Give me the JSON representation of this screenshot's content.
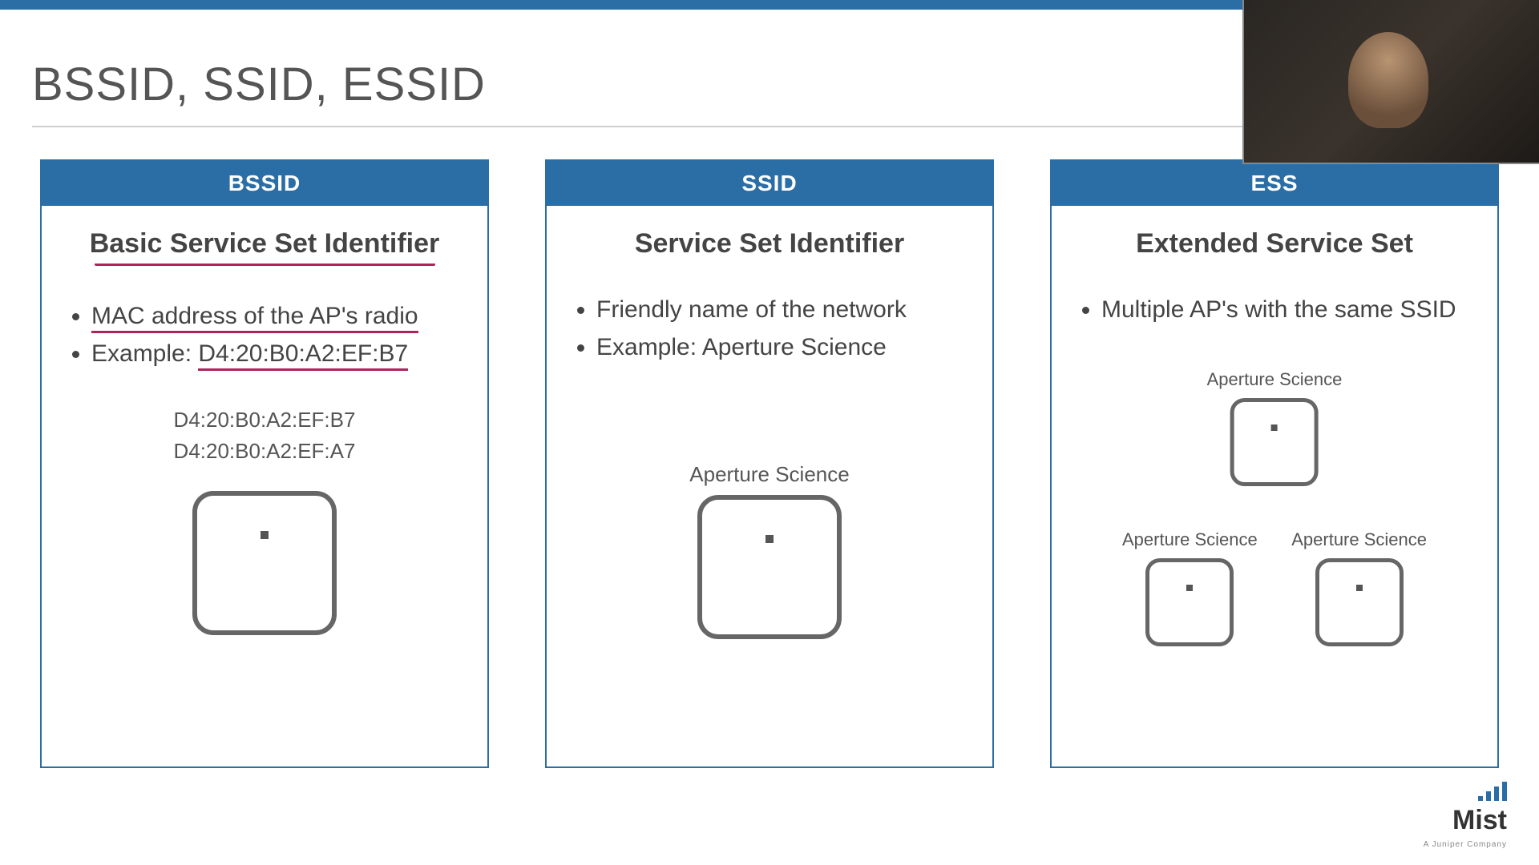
{
  "title": "BSSID, SSID, ESSID",
  "cards": {
    "bssid": {
      "header": "BSSID",
      "subtitle": "Basic Service Set Identifier",
      "bullet1": "MAC address of the AP's radio",
      "bullet2_prefix": "Example: ",
      "bullet2_value": "D4:20:B0:A2:EF:B7",
      "mac1": "D4:20:B0:A2:EF:B7",
      "mac2": "D4:20:B0:A2:EF:A7"
    },
    "ssid": {
      "header": "SSID",
      "subtitle": "Service Set Identifier",
      "bullet1": "Friendly name of the network",
      "bullet2": "Example: Aperture Science",
      "ap_label": "Aperture Science"
    },
    "ess": {
      "header": "ESS",
      "subtitle": "Extended Service Set",
      "bullet1": "Multiple AP's with the same SSID",
      "ap_label": "Aperture Science"
    }
  },
  "logo": {
    "name": "Mist",
    "sub": "A Juniper Company"
  }
}
